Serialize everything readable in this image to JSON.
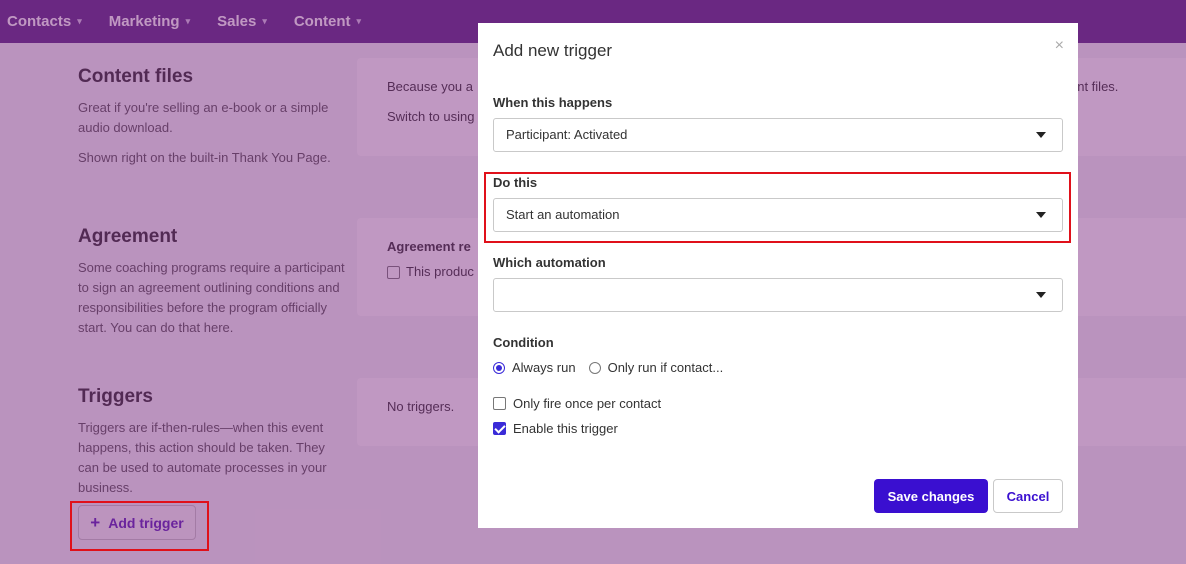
{
  "nav": {
    "items": [
      {
        "label": "Contacts"
      },
      {
        "label": "Marketing"
      },
      {
        "label": "Sales"
      },
      {
        "label": "Content"
      }
    ],
    "caret": "▾"
  },
  "sections": {
    "content_files": {
      "title": "Content files",
      "desc1": "Great if you're selling an e-book or a simple audio download.",
      "desc2": "Shown right on the built-in Thank You Page.",
      "card_line1": "Because you a",
      "card_line1_end": "ent files.",
      "card_line2": "Switch to using"
    },
    "agreement": {
      "title": "Agreement",
      "desc": "Some coaching programs require a participant to sign an agreement outlining conditions and responsibilities before the program officially start. You can do that here.",
      "card_label": "Agreement re",
      "card_check_label": "This produc"
    },
    "triggers": {
      "title": "Triggers",
      "desc": "Triggers are if-then-rules—when this event happens, this action should be taken. They can be used to automate processes in your business.",
      "card_text": "No triggers.",
      "add_button": "Add trigger",
      "add_icon": "+"
    }
  },
  "modal": {
    "title": "Add new trigger",
    "close": "×",
    "when_label": "When this happens",
    "when_value": "Participant: Activated",
    "do_label": "Do this",
    "do_value": "Start an automation",
    "which_label": "Which automation",
    "which_value": "",
    "condition_label": "Condition",
    "radio_always": "Always run",
    "radio_only": "Only run if contact...",
    "check_once": "Only fire once per contact",
    "check_enable": "Enable this trigger",
    "save": "Save changes",
    "cancel": "Cancel"
  },
  "colors": {
    "nav_bg": "#5b2a84",
    "overlay": "#7c2880",
    "primary": "#3a0fd0",
    "highlight": "#e0101a"
  }
}
